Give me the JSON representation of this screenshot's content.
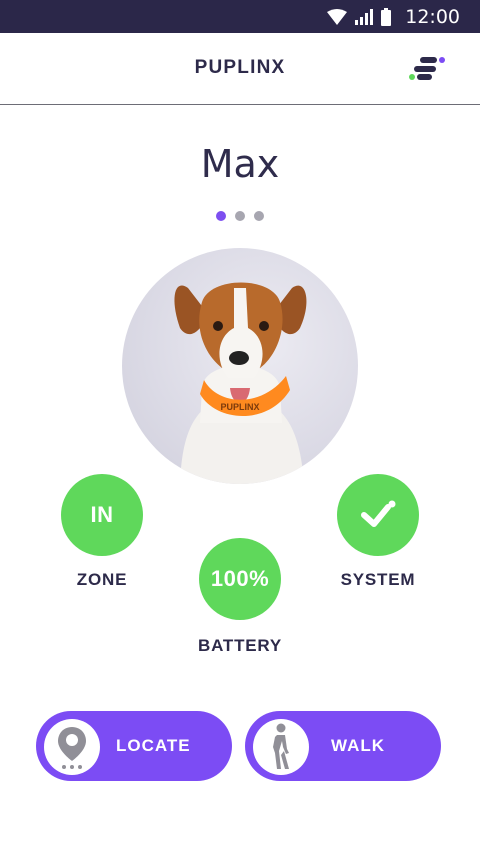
{
  "status_bar": {
    "time": "12:00",
    "icons": [
      "wifi-icon",
      "cell-signal-icon",
      "battery-icon"
    ]
  },
  "header": {
    "title": "PUPLINX",
    "menu_icon": "menu-icon"
  },
  "pet": {
    "name": "Max",
    "pager": {
      "count": 3,
      "active_index": 0
    },
    "photo": "dog-photo",
    "collar_text": "PUPLINX"
  },
  "stats": {
    "zone": {
      "value": "IN",
      "label": "ZONE"
    },
    "battery": {
      "value": "100%",
      "label": "BATTERY"
    },
    "system": {
      "value_icon": "check-icon",
      "label": "SYSTEM"
    }
  },
  "actions": {
    "locate": {
      "label": "LOCATE",
      "icon": "location-pin-icon"
    },
    "walk": {
      "label": "WALK",
      "icon": "walking-person-icon"
    }
  },
  "colors": {
    "status_bar_bg": "#2b2749",
    "primary": "#7c4cf4",
    "success": "#5fd85b",
    "text_dark": "#2d2a4a"
  }
}
